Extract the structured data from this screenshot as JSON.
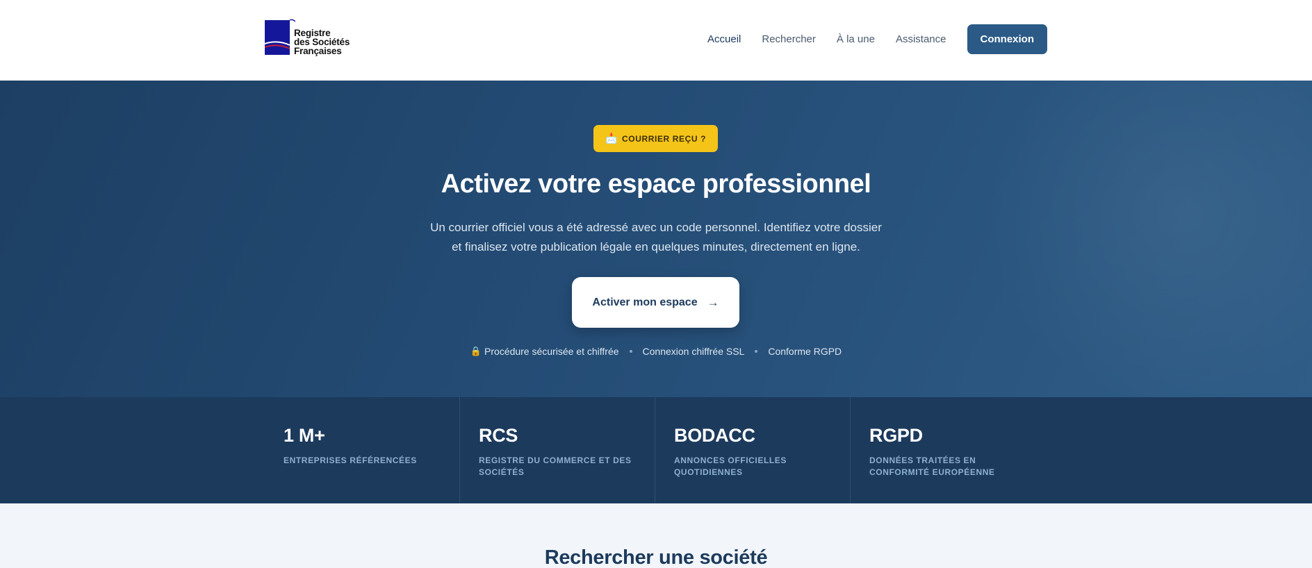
{
  "header": {
    "logo": {
      "line1": "Registre",
      "line2": "des Sociétés",
      "line3": "Françaises",
      "icon": "book-flag-icon"
    },
    "nav": {
      "items": [
        {
          "label": "Accueil",
          "active": true
        },
        {
          "label": "Rechercher",
          "active": false
        },
        {
          "label": "À la une",
          "active": false
        },
        {
          "label": "Assistance",
          "active": false
        }
      ],
      "login_label": "Connexion"
    }
  },
  "hero": {
    "badge": {
      "icon": "mailbox-icon",
      "label": "COURRIER REÇU ?"
    },
    "title": "Activez votre espace professionnel",
    "subtitle_line1": "Un courrier officiel vous a été adressé avec un code personnel. Identifiez votre dossier",
    "subtitle_line2": "et finalisez votre publication légale en quelques minutes, directement en ligne.",
    "cta": {
      "label": "Activer mon espace",
      "arrow": "→"
    },
    "trust": [
      {
        "icon": "lock-icon",
        "label": "Procédure sécurisée et chiffrée"
      },
      {
        "label": "Connexion chiffrée SSL"
      },
      {
        "label": "Conforme RGPD"
      }
    ]
  },
  "stats": [
    {
      "value": "1 M+",
      "label": "ENTREPRISES RÉFÉRENCÉES"
    },
    {
      "value": "RCS",
      "label": "REGISTRE DU COMMERCE ET DES SOCIÉTÉS"
    },
    {
      "value": "BODACC",
      "label": "ANNONCES OFFICIELLES QUOTIDIENNES"
    },
    {
      "value": "RGPD",
      "label": "DONNÉES TRAITÉES EN CONFORMITÉ EUROPÉENNE"
    }
  ],
  "search": {
    "title": "Rechercher une société"
  },
  "colors": {
    "primary": "#1c3a5c",
    "button": "#2b5a86",
    "badge": "#f5c419",
    "hero_start": "#1d3f63",
    "hero_end": "#2f5d87"
  }
}
